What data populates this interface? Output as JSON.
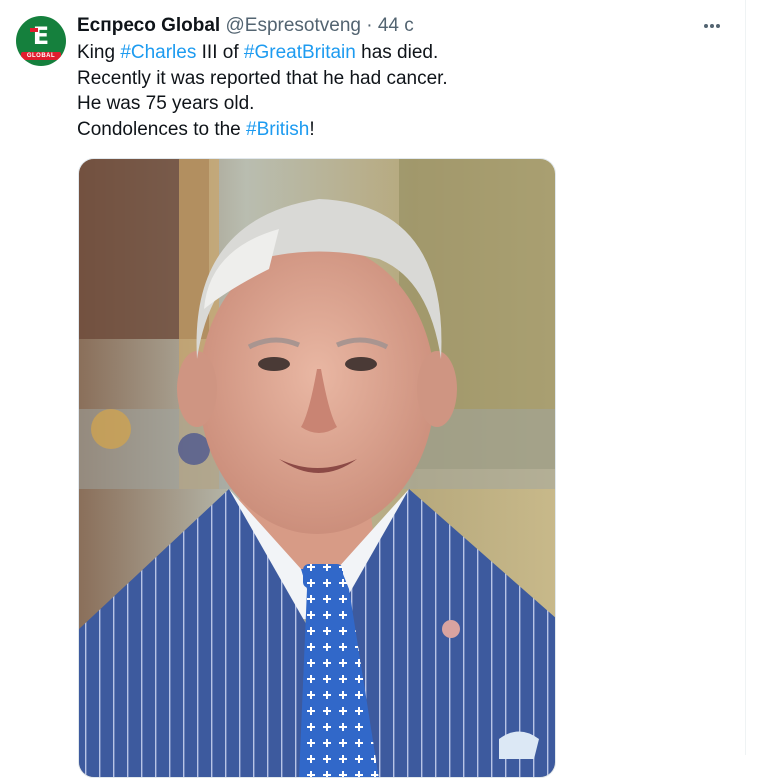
{
  "author": {
    "display_name": "Еспресо Global",
    "handle": "@Espresotveng",
    "separator": "·",
    "time": "44 с",
    "avatar_letter": "E",
    "avatar_band_text": "GLOBAL"
  },
  "tweet": {
    "line1": {
      "pre": "King ",
      "tag1": "#Charles",
      "mid": " III of ",
      "tag2": "#GreatBritain",
      "post": " has died."
    },
    "line2": "Recently it was reported that he had cancer.",
    "line3": "He was 75 years old.",
    "line4": {
      "pre": "Condolences to the ",
      "tag": "#British",
      "post": "!"
    }
  },
  "media": {
    "icon": "photo-of-king-charles",
    "colors": {
      "suit": "#3d5a9e",
      "shirt": "#f2f4f7",
      "tie": "#3168c9",
      "background": "#a8a990"
    }
  },
  "icons": {
    "more": "more-horizontal-icon"
  },
  "colors": {
    "link": "#1d9bf0",
    "text": "#0f1419",
    "secondary": "#536471",
    "avatar_green": "#15803d",
    "avatar_red": "#e11d2e"
  }
}
